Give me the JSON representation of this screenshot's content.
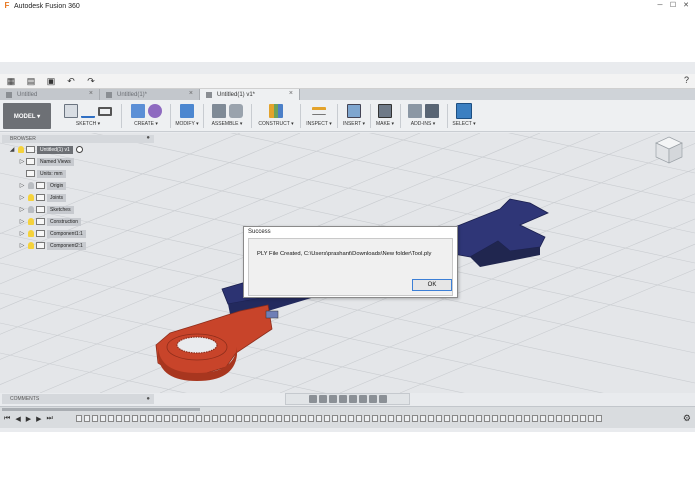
{
  "window": {
    "app_title": "Autodesk Fusion 360",
    "controls": [
      "─",
      "☐",
      "✕"
    ]
  },
  "quick_access": {
    "help_icon": "?"
  },
  "tabs": [
    {
      "label": "Untitled",
      "active": false
    },
    {
      "label": "Untitled(1)*",
      "active": false
    },
    {
      "label": "Untitled(1) v1*",
      "active": true
    }
  ],
  "toolbar": {
    "workspace_label": "MODEL ▾",
    "groups": [
      {
        "label": "SKETCH ▾"
      },
      {
        "label": "CREATE ▾"
      },
      {
        "label": "MODIFY ▾"
      },
      {
        "label": "ASSEMBLE ▾"
      },
      {
        "label": "CONSTRUCT ▾"
      },
      {
        "label": "INSPECT ▾"
      },
      {
        "label": "INSERT ▾"
      },
      {
        "label": "MAKE ▾"
      },
      {
        "label": "ADD-INS ▾"
      },
      {
        "label": "SELECT ▾"
      }
    ]
  },
  "browser": {
    "title": "BROWSER",
    "items": [
      {
        "label": "Untitled(1) v1"
      },
      {
        "label": "Named Views"
      },
      {
        "label": "Units: mm"
      },
      {
        "label": "Origin"
      },
      {
        "label": "Joints"
      },
      {
        "label": "Sketches"
      },
      {
        "label": "Construction"
      },
      {
        "label": "Component1:1"
      },
      {
        "label": "Component2:1"
      }
    ]
  },
  "dialog": {
    "title": "Success",
    "message": "PLY File Created, C:\\Users\\prashant\\Downloads\\New folder\\Tool.ply",
    "ok_label": "OK"
  },
  "comments": {
    "title": "COMMENTS"
  },
  "colors": {
    "wrench_blue": "#2f3677",
    "wrench_red": "#c8442a",
    "toolbar_bg": "#eef0f2"
  }
}
